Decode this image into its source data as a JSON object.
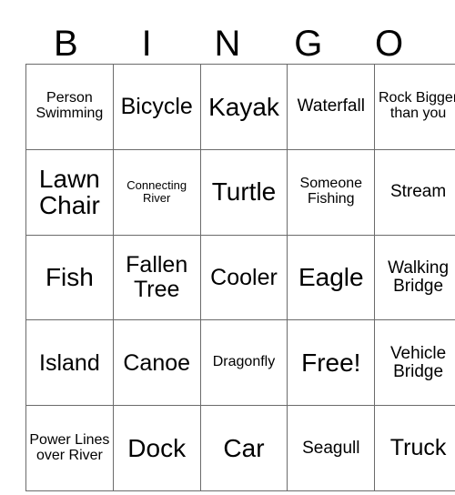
{
  "card": {
    "title": "BINGO",
    "header_letters": [
      "B",
      "I",
      "N",
      "G",
      "O"
    ],
    "grid_size": "5x5",
    "colors": {
      "background": "#ffffff",
      "text": "#000000",
      "border": "#6b6b6b"
    },
    "free_space": {
      "label": "Free!",
      "row": 4,
      "column": 3
    },
    "rows": [
      [
        {
          "label": "Person Swimming",
          "size": "fs-sm"
        },
        {
          "label": "Bicycle",
          "size": "fs-lg"
        },
        {
          "label": "Kayak",
          "size": "fs-xl"
        },
        {
          "label": "Waterfall",
          "size": "fs-md"
        },
        {
          "label": "Rock Bigger than you",
          "size": "fs-sm"
        }
      ],
      [
        {
          "label": "Lawn Chair",
          "size": "fs-xl"
        },
        {
          "label": "Connecting River",
          "size": "fs-xs"
        },
        {
          "label": "Turtle",
          "size": "fs-xl"
        },
        {
          "label": "Someone Fishing",
          "size": "fs-sm"
        },
        {
          "label": "Stream",
          "size": "fs-md"
        }
      ],
      [
        {
          "label": "Fish",
          "size": "fs-xl"
        },
        {
          "label": "Fallen Tree",
          "size": "fs-lg"
        },
        {
          "label": "Cooler",
          "size": "fs-lg"
        },
        {
          "label": "Eagle",
          "size": "fs-xl"
        },
        {
          "label": "Walking Bridge",
          "size": "fs-md"
        }
      ],
      [
        {
          "label": "Island",
          "size": "fs-lg"
        },
        {
          "label": "Canoe",
          "size": "fs-lg"
        },
        {
          "label": "Dragonfly",
          "size": "fs-sm"
        },
        {
          "label": "Free!",
          "size": "fs-xl"
        },
        {
          "label": "Vehicle Bridge",
          "size": "fs-md"
        }
      ],
      [
        {
          "label": "Power Lines over River",
          "size": "fs-sm"
        },
        {
          "label": "Dock",
          "size": "fs-xl"
        },
        {
          "label": "Car",
          "size": "fs-xl"
        },
        {
          "label": "Seagull",
          "size": "fs-md"
        },
        {
          "label": "Truck",
          "size": "fs-lg"
        }
      ]
    ]
  }
}
